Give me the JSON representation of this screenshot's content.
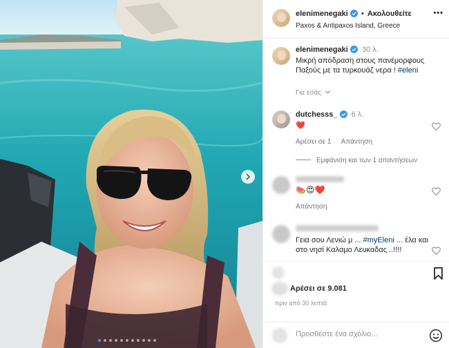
{
  "post": {
    "username": "elenimenegaki",
    "separator": "•",
    "follow_label": "Ακολουθείτε",
    "location": "Paxos & Antipaxos Island, Greece",
    "more_label": "•••"
  },
  "caption": {
    "username": "elenimenegaki",
    "time": "30 λ.",
    "text": "Μικρή απόδραση στους πανέμορφους Παξούς με τα τυρκουάζ νερα ! ",
    "hashtag": "#eleni",
    "for_you": "Για εσάς"
  },
  "comments": [
    {
      "username": "dutchesss_",
      "time": "6 λ.",
      "emoji": "❤️",
      "likes": "Αρέσει σε 1",
      "reply_label": "Απάντηση",
      "show_replies": "Εμφάνιση και των 1 απαντήσεων"
    },
    {
      "emoji": "🍉😍❤️",
      "reply_label": "Απάντηση"
    },
    {
      "text": "Γεια σου Λενιώ μ ... ",
      "hashtag": "#myEleni",
      "text_after": " ... έλα και στο νησί Καλαμο Λευκαδας ..!!!!"
    }
  ],
  "footer": {
    "likes": "Αρέσει σε 9.081",
    "ago": "πριν από 30 λεπτά",
    "comment_placeholder": "Προσθέστε ένα σχόλιο..."
  },
  "carousel": {
    "total_dots": 11,
    "active_index": 0
  },
  "colors": {
    "verified": "#3897f0",
    "hashtag": "#00376b",
    "heart": "#ed4956",
    "sea": "#2aa8b0"
  },
  "icons": [
    "verified-badge-icon",
    "heart-outline-icon",
    "chevron-down-icon",
    "chevron-right-icon",
    "bookmark-icon",
    "smiley-icon"
  ]
}
